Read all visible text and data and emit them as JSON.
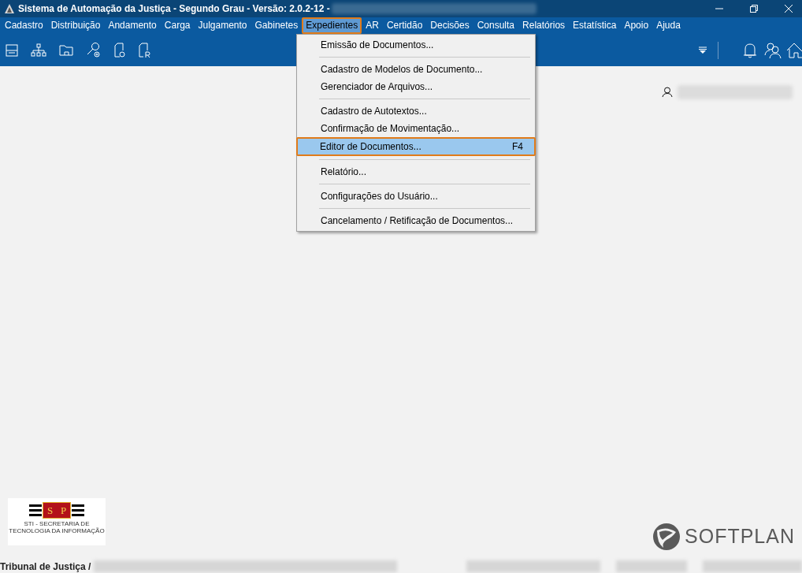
{
  "window": {
    "title": "Sistema de Automação da Justiça - Segundo Grau - Versão: 2.0.2-12 -"
  },
  "menu_bar": [
    {
      "label": "Cadastro",
      "selected": false
    },
    {
      "label": "Distribuição",
      "selected": false
    },
    {
      "label": "Andamento",
      "selected": false
    },
    {
      "label": "Carga",
      "selected": false
    },
    {
      "label": "Julgamento",
      "selected": false
    },
    {
      "label": "Gabinetes",
      "selected": false
    },
    {
      "label": "Expedientes",
      "selected": true
    },
    {
      "label": "AR",
      "selected": false
    },
    {
      "label": "Certidão",
      "selected": false
    },
    {
      "label": "Decisões",
      "selected": false
    },
    {
      "label": "Consulta",
      "selected": false
    },
    {
      "label": "Relatórios",
      "selected": false
    },
    {
      "label": "Estatística",
      "selected": false
    },
    {
      "label": "Apoio",
      "selected": false
    },
    {
      "label": "Ajuda",
      "selected": false
    }
  ],
  "dropdown": [
    {
      "kind": "item",
      "label": "Emissão de Documentos...",
      "selected": false
    },
    {
      "kind": "separator"
    },
    {
      "kind": "item",
      "label": "Cadastro de Modelos de Documento...",
      "selected": false
    },
    {
      "kind": "item",
      "label": "Gerenciador de Arquivos...",
      "selected": false
    },
    {
      "kind": "separator"
    },
    {
      "kind": "item",
      "label": "Cadastro de Autotextos...",
      "selected": false
    },
    {
      "kind": "item",
      "label": "Confirmação de Movimentação...",
      "selected": false
    },
    {
      "kind": "item",
      "label": "Editor de Documentos...",
      "shortcut": "F4",
      "selected": true
    },
    {
      "kind": "separator"
    },
    {
      "kind": "item",
      "label": "Relatório...",
      "selected": false
    },
    {
      "kind": "separator"
    },
    {
      "kind": "item",
      "label": "Configurações do Usuário...",
      "selected": false
    },
    {
      "kind": "separator"
    },
    {
      "kind": "item",
      "label": "Cancelamento / Retificação de Documentos...",
      "selected": false
    }
  ],
  "logo": {
    "letters": [
      "S",
      "P"
    ],
    "caption": [
      "STI - SECRETARIA DE",
      "TECNOLOGIA DA INFORMAÇÃO"
    ]
  },
  "brand": "SOFTPLAN",
  "status_bar": {
    "text": "Tribunal de Justiça /"
  }
}
